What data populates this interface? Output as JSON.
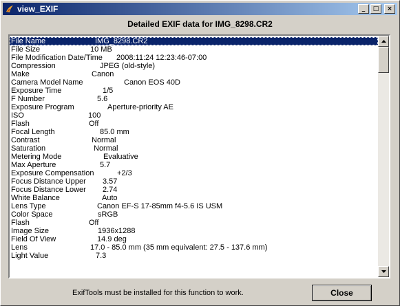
{
  "window": {
    "title": "view_EXIF",
    "minimize_label": "_",
    "maximize_label": "□",
    "close_label": "×"
  },
  "header": {
    "title": "Detailed EXIF data for IMG_8298.CR2"
  },
  "exif": [
    {
      "key": "File Name",
      "value": "IMG_8298.CR2",
      "selected": true
    },
    {
      "key": "File Size",
      "value": "10 MB"
    },
    {
      "key": "File Modification Date/Time",
      "value": "2008:11:24 12:23:46-07:00"
    },
    {
      "key": "Compression",
      "value": "JPEG (old-style)"
    },
    {
      "key": "Make",
      "value": "Canon"
    },
    {
      "key": "Camera Model Name",
      "value": "Canon EOS 40D"
    },
    {
      "key": "Exposure Time",
      "value": "1/5"
    },
    {
      "key": "F Number",
      "value": "5.6"
    },
    {
      "key": "Exposure Program",
      "value": "Aperture-priority AE"
    },
    {
      "key": "ISO",
      "value": "100"
    },
    {
      "key": "Flash",
      "value": "Off"
    },
    {
      "key": "Focal Length",
      "value": "85.0 mm"
    },
    {
      "key": "Contrast",
      "value": "Normal"
    },
    {
      "key": "Saturation",
      "value": "Normal"
    },
    {
      "key": "Metering Mode",
      "value": "Evaluative"
    },
    {
      "key": "Max Aperture",
      "value": "5.7"
    },
    {
      "key": "Exposure Compensation",
      "value": "+2/3"
    },
    {
      "key": "Focus Distance Upper",
      "value": "3.57"
    },
    {
      "key": "Focus Distance Lower",
      "value": "2.74"
    },
    {
      "key": "White Balance",
      "value": "Auto"
    },
    {
      "key": "Lens Type",
      "value": "Canon EF-S 17-85mm f4-5.6 IS USM"
    },
    {
      "key": "Color Space",
      "value": "sRGB"
    },
    {
      "key": "Flash",
      "value": "Off"
    },
    {
      "key": "Image Size",
      "value": "1936x1288"
    },
    {
      "key": "Field Of View",
      "value": "14.9 deg"
    },
    {
      "key": "Lens",
      "value": "17.0 - 85.0 mm (35 mm equivalent: 27.5 - 137.6 mm)"
    },
    {
      "key": "Light Value",
      "value": "7.3"
    }
  ],
  "scrollbar": {
    "up_icon": "arrow-up-icon",
    "down_icon": "arrow-down-icon"
  },
  "footer": {
    "message": "ExifTools must be installed for this function to work.",
    "close_button": "Close"
  }
}
